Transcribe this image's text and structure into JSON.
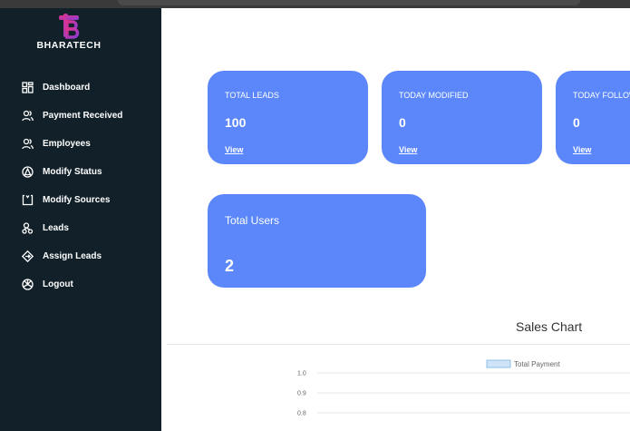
{
  "sidebar": {
    "logo_text": "BHARATECH",
    "items": [
      {
        "label": "Dashboard",
        "icon": "dashboard-grid-icon"
      },
      {
        "label": "Payment Received",
        "icon": "users-icon"
      },
      {
        "label": "Employees",
        "icon": "users-icon"
      },
      {
        "label": "Modify Status",
        "icon": "status-circle-icon"
      },
      {
        "label": "Modify Sources",
        "icon": "sources-icon"
      },
      {
        "label": "Leads",
        "icon": "leads-icon"
      },
      {
        "label": "Assign Leads",
        "icon": "assign-diamond-icon"
      },
      {
        "label": "Logout",
        "icon": "logout-icon"
      }
    ]
  },
  "cards": [
    {
      "title": "TOTAL LEADS",
      "value": "100",
      "link": "View"
    },
    {
      "title": "TODAY MODIFIED",
      "value": "0",
      "link": "View"
    },
    {
      "title": "TODAY FOLLOW UP",
      "value": "0",
      "link": "View"
    }
  ],
  "users_card": {
    "title": "Total Users",
    "value": "2"
  },
  "chart": {
    "title": "Sales Chart",
    "legend": "Total Payment",
    "ticks": [
      "1.0",
      "0.9",
      "0.8"
    ]
  },
  "chart_data": {
    "type": "bar",
    "title": "Sales Chart",
    "series": [
      {
        "name": "Total Payment",
        "values": []
      }
    ],
    "categories": [],
    "ylim": [
      0.8,
      1.0
    ],
    "yticks": [
      "1.0",
      "0.9",
      "0.8"
    ],
    "grid": true,
    "legend": "top"
  },
  "colors": {
    "sidebar_bg": "#112029",
    "card_bg": "#5b87fb",
    "legend_fill": "#cfe4f7"
  }
}
